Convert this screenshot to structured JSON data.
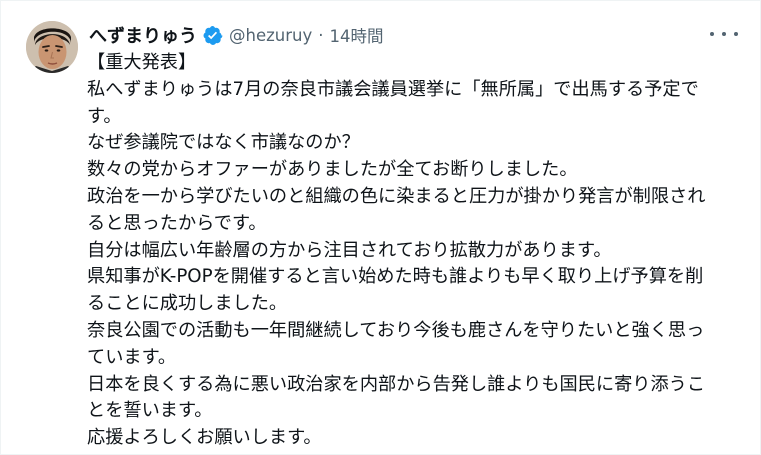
{
  "author": {
    "display_name": "へずまりゅう",
    "handle": "@hezuruy",
    "separator": "·",
    "time": "14時間",
    "verified": true
  },
  "icons": {
    "verified": "verified-badge-icon",
    "more": "more-options-icon"
  },
  "colors": {
    "verified_blue": "#1d9bf0",
    "text": "#0f1419",
    "secondary": "#536471"
  },
  "tweet": {
    "lines": [
      "【重大発表】",
      "私へずまりゅうは7月の奈良市議会議員選挙に「無所属」で出馬する予定で",
      "す。",
      "なぜ参議院ではなく市議なのか？",
      "数々の党からオファーがありましたが全てお断りしました。",
      "政治を一から学びたいのと組織の色に染まると圧力が掛かり発言が制限され",
      "ると思ったからです。",
      "自分は幅広い年齢層の方から注目されており拡散力があります。",
      "県知事がK-POPを開催すると言い始めた時も誰よりも早く取り上げ予算を削",
      "ることに成功しました。",
      "奈良公園での活動も一年間継続しており今後も鹿さんを守りたいと強く思っ",
      "ています。",
      "日本を良くする為に悪い政治家を内部から告発し誰よりも国民に寄り添うこ",
      "とを誓います。",
      "応援よろしくお願いします。"
    ]
  }
}
